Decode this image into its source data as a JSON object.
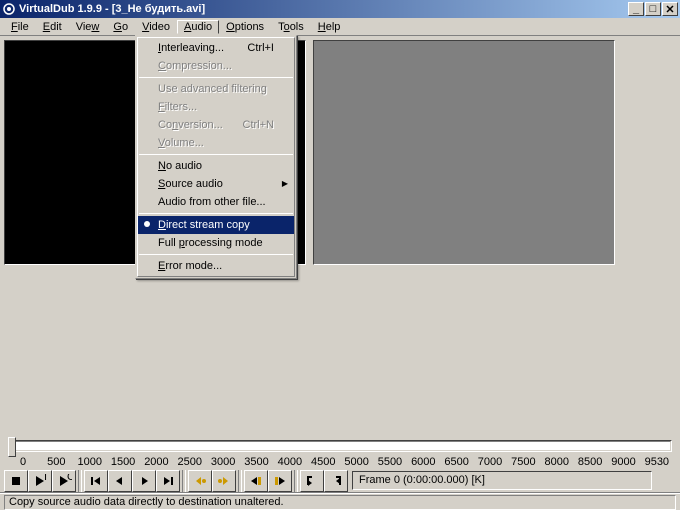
{
  "window": {
    "title": "VirtualDub 1.9.9 - [3_Не будить.avi]"
  },
  "menubar": {
    "file": "File",
    "edit": "Edit",
    "view": "View",
    "go": "Go",
    "video": "Video",
    "audio": "Audio",
    "options": "Options",
    "tools": "Tools",
    "help": "Help"
  },
  "audio_menu": {
    "interleaving": "Interleaving...",
    "interleaving_shortcut": "Ctrl+I",
    "compression": "Compression...",
    "use_advanced_filtering": "Use advanced filtering",
    "filters": "Filters...",
    "conversion": "Conversion...",
    "conversion_shortcut": "Ctrl+N",
    "volume": "Volume...",
    "no_audio": "No audio",
    "source_audio": "Source audio",
    "audio_from_other_file": "Audio from other file...",
    "direct_stream_copy": "Direct stream copy",
    "full_processing_mode": "Full processing mode",
    "error_mode": "Error mode..."
  },
  "timeline": {
    "ticks": [
      "0",
      "500",
      "1000",
      "1500",
      "2000",
      "2500",
      "3000",
      "3500",
      "4000",
      "4500",
      "5000",
      "5500",
      "6000",
      "6500",
      "7000",
      "7500",
      "8000",
      "8500",
      "9000",
      "9530"
    ]
  },
  "frame_info": "Frame 0 (0:00:00.000) [K]",
  "status": "Copy source audio data directly to destination unaltered."
}
